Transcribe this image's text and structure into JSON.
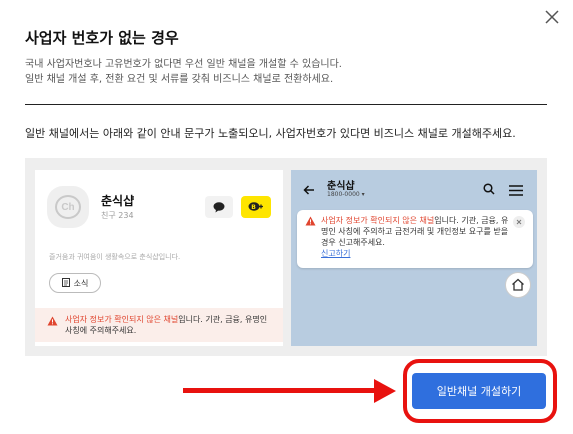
{
  "modal": {
    "title": "사업자 번호가 없는 경우",
    "desc_line1": "국내 사업자번호나 고유번호가 없다면 우선 일반 채널을 개설할 수 있습니다.",
    "desc_line2": "일반 채널 개설 후, 전환 요건 및 서류를 갖춰 비즈니스 채널로 전환하세요.",
    "notice": "일반 채널에서는 아래와 같이 안내 문구가 노출되오니, 사업자번호가 있다면 비즈니스 채널로 개설해주세요.",
    "primary_button": "일반채널 개설하기"
  },
  "preview_left": {
    "avatar_text": "Ch",
    "channel_name": "춘식샵",
    "friends": "친구 234",
    "intro": "즐거움과 귀여움이 생활속으로 춘식샵입니다.",
    "news_button": "소식",
    "warning_red": "사업자 정보가 확인되지 않은 채널",
    "warning_rest": "입니다. 기관, 금융, 유명인 사칭에 주의해주세요."
  },
  "preview_right": {
    "channel_name": "춘식샵",
    "phone": "1800-0000 ▾",
    "warning_red": "사업자 정보가 확인되지 않은 채널",
    "warning_rest": "입니다. 기관, 금융, 유명인 사칭에 주의하고 금전거래 및 개인정보 요구를 받을 경우 신고해주세요.",
    "report_link": "신고하기"
  },
  "colors": {
    "primary": "#2f6fde",
    "annotation_red": "#e8120f",
    "kakao_yellow": "#fee500",
    "warning_red": "#e0452f",
    "chatroom_bg": "#b8cce0"
  }
}
